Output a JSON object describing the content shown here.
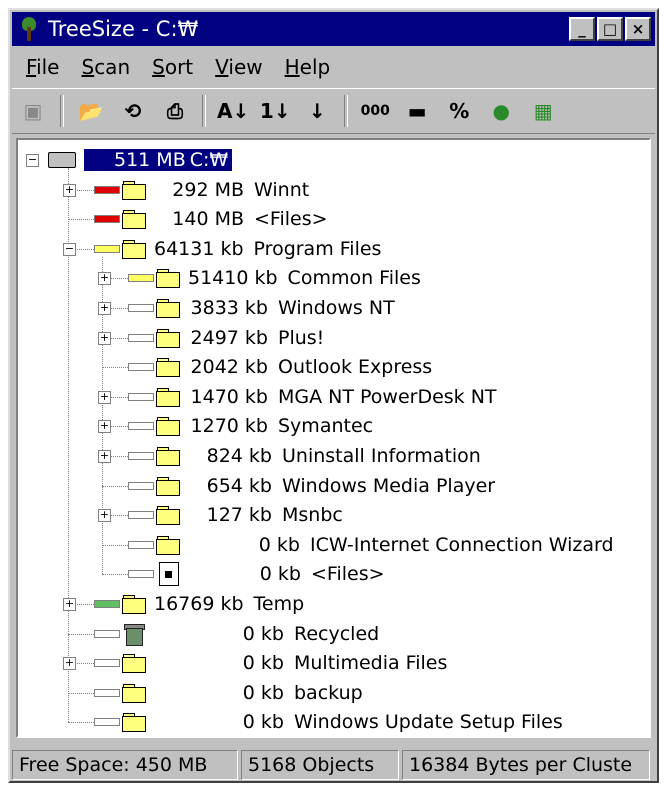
{
  "window": {
    "title": "TreeSize - C:₩"
  },
  "title_buttons": {
    "minimize": "_",
    "maximize": "□",
    "close": "×"
  },
  "menu": [
    "File",
    "Scan",
    "Sort",
    "View",
    "Help"
  ],
  "toolbar": {
    "sort_alpha_label": "A↓",
    "sort_size_label": "1↓",
    "sort_desc_label": "↓",
    "show_size_label": "000",
    "percent_label": "%"
  },
  "tree": [
    {
      "size": "511 MB",
      "name": "C:₩",
      "bar": "none",
      "selected": true,
      "icon": "drive-icon"
    },
    {
      "size": "292 MB",
      "name": "Winnt",
      "bar": "red",
      "icon": "folder-icon"
    },
    {
      "size": "140 MB",
      "name": "<Files>",
      "bar": "red",
      "icon": "folder-icon"
    },
    {
      "size": "64131 kb",
      "name": "Program Files",
      "bar": "yellow",
      "icon": "folder-icon"
    },
    {
      "size": "51410 kb",
      "name": "Common Files",
      "bar": "yellow",
      "icon": "folder-icon"
    },
    {
      "size": "3833 kb",
      "name": "Windows NT",
      "bar": "empty",
      "icon": "folder-icon"
    },
    {
      "size": "2497 kb",
      "name": "Plus!",
      "bar": "empty",
      "icon": "folder-icon"
    },
    {
      "size": "2042 kb",
      "name": "Outlook Express",
      "bar": "empty",
      "icon": "folder-icon"
    },
    {
      "size": "1470 kb",
      "name": "MGA NT PowerDesk NT",
      "bar": "empty",
      "icon": "folder-icon"
    },
    {
      "size": "1270 kb",
      "name": "Symantec",
      "bar": "empty",
      "icon": "folder-icon"
    },
    {
      "size": "824 kb",
      "name": "Uninstall Information",
      "bar": "empty",
      "icon": "folder-icon"
    },
    {
      "size": "654 kb",
      "name": "Windows Media Player",
      "bar": "empty",
      "icon": "folder-icon"
    },
    {
      "size": "127 kb",
      "name": "Msnbc",
      "bar": "empty",
      "icon": "folder-icon"
    },
    {
      "size": "0 kb",
      "name": "ICW-Internet Connection Wizard",
      "bar": "empty",
      "icon": "folder-icon"
    },
    {
      "size": "0 kb",
      "name": "<Files>",
      "bar": "empty",
      "icon": "file-icon"
    },
    {
      "size": "16769 kb",
      "name": "Temp",
      "bar": "green",
      "icon": "folder-icon"
    },
    {
      "size": "0 kb",
      "name": "Recycled",
      "bar": "empty",
      "icon": "recycle-bin-icon"
    },
    {
      "size": "0 kb",
      "name": "Multimedia Files",
      "bar": "empty",
      "icon": "folder-icon"
    },
    {
      "size": "0 kb",
      "name": "backup",
      "bar": "empty",
      "icon": "folder-icon"
    },
    {
      "size": "0 kb",
      "name": "Windows Update Setup Files",
      "bar": "empty",
      "icon": "folder-icon"
    }
  ],
  "colors": {
    "red": "#e00000",
    "yellow": "#ffff60",
    "green": "#60c060",
    "empty": "#ffffff",
    "selection": "#000080"
  },
  "status": {
    "free_space": "Free Space: 450 MB",
    "objects": "5168 Objects",
    "cluster": "16384 Bytes per Cluste"
  }
}
